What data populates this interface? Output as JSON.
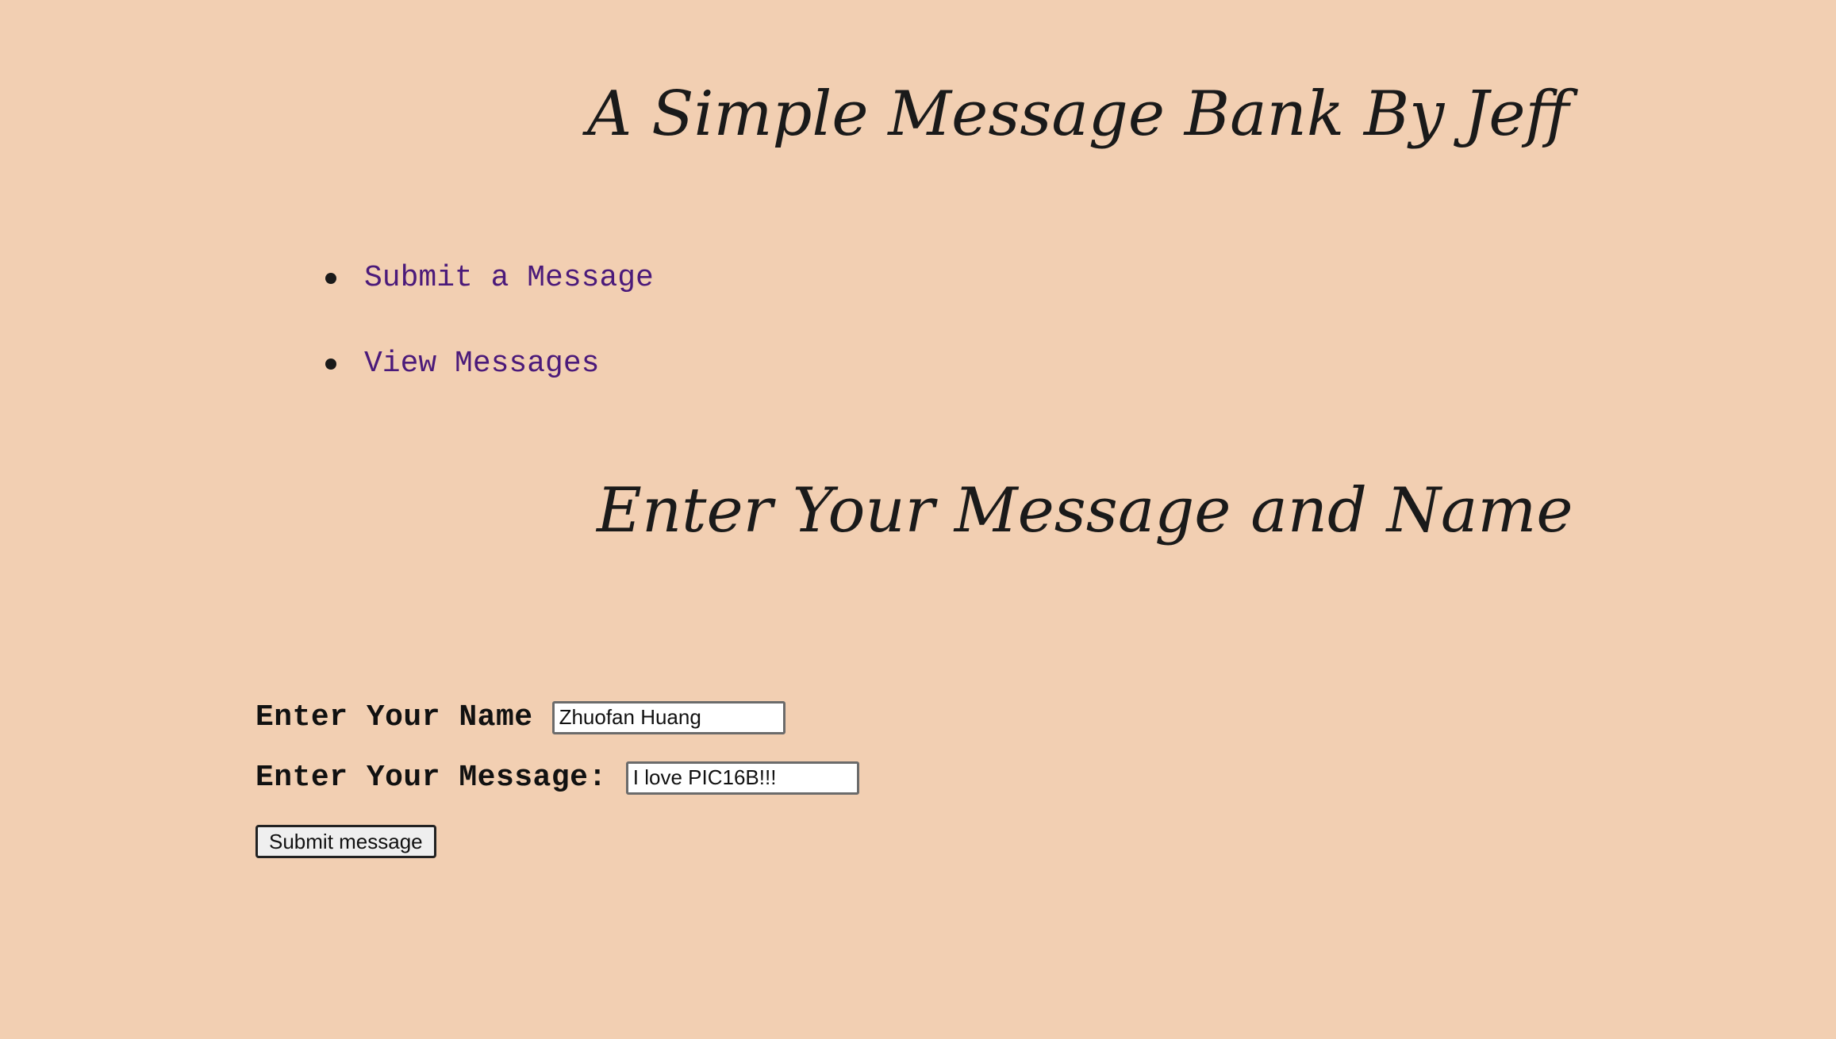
{
  "header": {
    "title": "A Simple Message Bank By Jeff"
  },
  "nav": {
    "items": [
      {
        "label": "Submit a Message"
      },
      {
        "label": "View Messages"
      }
    ]
  },
  "section": {
    "title": "Enter Your Message and Name"
  },
  "form": {
    "name_label": "Enter Your Name",
    "name_value": "Zhuofan Huang",
    "message_label": "Enter Your Message:",
    "message_value": "I love PIC16B!!!",
    "submit_label": "Submit message"
  },
  "colors": {
    "background": "#f2cfb2",
    "link": "#4b1a7a",
    "text": "#1a1a1a"
  }
}
